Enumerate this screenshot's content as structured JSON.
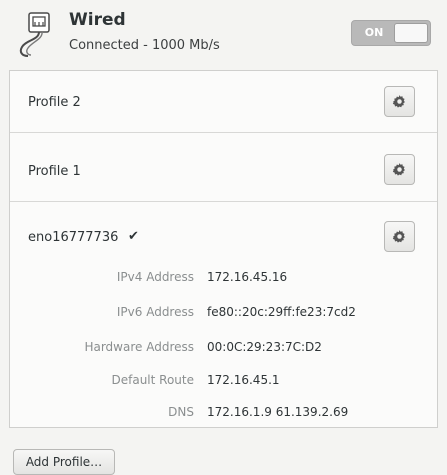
{
  "header": {
    "title": "Wired",
    "status": "Connected - 1000 Mb/s",
    "toggle_label": "ON",
    "toggle_state": true,
    "icon": "network-wired-icon"
  },
  "profiles": [
    {
      "label": "Profile 2",
      "icon": "gear-icon"
    },
    {
      "label": "Profile 1",
      "icon": "gear-icon"
    }
  ],
  "active_connection": {
    "label": "eno16777736",
    "check_icon": "checkmark-icon",
    "details": [
      {
        "label": "IPv4 Address",
        "value": "172.16.45.16"
      },
      {
        "label": "IPv6 Address",
        "value": "fe80::20c:29ff:fe23:7cd2"
      },
      {
        "label": "Hardware Address",
        "value": "00:0C:29:23:7C:D2"
      },
      {
        "label": "Default Route",
        "value": "172.16.45.1"
      },
      {
        "label": "DNS",
        "value": "172.16.1.9 61.139.2.69"
      }
    ]
  },
  "footer": {
    "add_profile_label": "Add Profile…"
  },
  "colors": {
    "background": "#f4f4f2",
    "panel": "#fbfbfa",
    "text": "#2e3436",
    "muted_label": "#8a8e8f"
  }
}
